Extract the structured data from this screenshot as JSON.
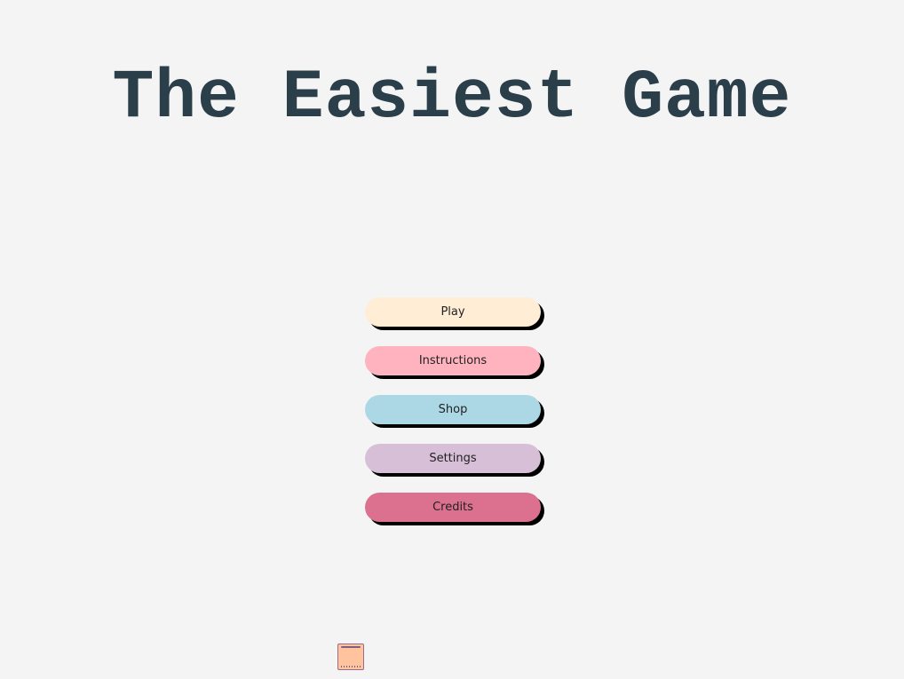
{
  "title": "The Easiest Game",
  "menu": {
    "buttons": [
      {
        "label": "Play",
        "color": "#ffedd6"
      },
      {
        "label": "Instructions",
        "color": "#ffb3be"
      },
      {
        "label": "Shop",
        "color": "#acd8e5"
      },
      {
        "label": "Settings",
        "color": "#d8bfd8"
      },
      {
        "label": "Credits",
        "color": "#db708f"
      }
    ]
  },
  "player": {
    "icon": "player-block-icon",
    "color": "#ffc39e"
  }
}
